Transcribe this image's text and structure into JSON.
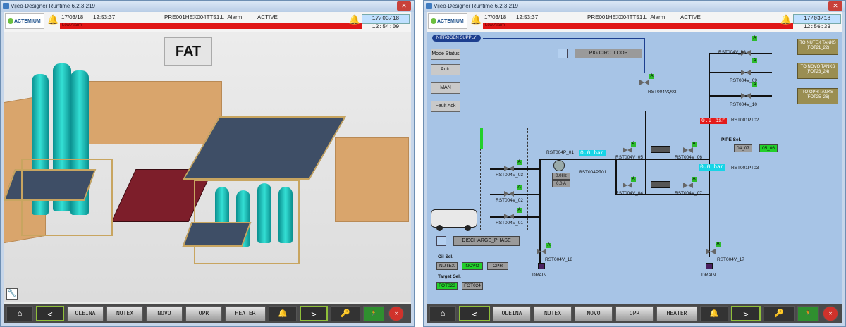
{
  "left_window": {
    "title": "Vijeo-Designer Runtime 6.2.3.219",
    "header": {
      "logo": "ACTEMIUM",
      "date": "17/03/18",
      "time": "12:53:37",
      "alarm_tag": "PRE001HEX004TT51.L_Alarm",
      "alarm_state": "ACTIVE",
      "alarm_text": "Low Alarm",
      "clock": "17/03/18 12:54:09"
    },
    "fat_label": "FAT",
    "nav": {
      "prev": "<",
      "items": [
        "OLEINA",
        "NUTEX",
        "NOVO",
        "OPR",
        "HEATER"
      ],
      "next": ">"
    }
  },
  "right_window": {
    "title": "Vijeo-Designer Runtime 6.2.3.219",
    "header": {
      "logo": "ACTEMIUM",
      "date": "17/03/18",
      "time": "12:53:37",
      "alarm_tag": "PRE001HEX004TT51.L_Alarm",
      "alarm_state": "ACTIVE",
      "alarm_text": "Low Alarm",
      "clock": "17/03/18 12:56:33"
    },
    "nitrogen_supply": "NITROGEN SUPPLY",
    "pig_loop": "PIG CIRC. LOOP",
    "side_buttons": [
      "Mode Status",
      "Auto",
      "MAN",
      "Fault Ack"
    ],
    "destinations": [
      "TO NUTEX TANKS (FOT21_22)",
      "TO NOVO TANKS (FOT23_24)",
      "TO OPR TANKS (FOT25_26)"
    ],
    "valves": {
      "v08": "RST004V_08",
      "v09": "RST004V_09",
      "v10": "RST004V_10",
      "vq03": "RST004VQ03",
      "v05": "RST004V_05",
      "v06": "RST004V_06",
      "v04": "RST004V_04",
      "v07": "RST004V_07",
      "v03": "RST004V_03",
      "v02": "RST004V_02",
      "v01": "RST004V_01",
      "v18": "RST004V_18",
      "v17": "RST004V_17"
    },
    "pt02_value": "0.0 bar",
    "pt02_tag": "RST001PT02",
    "pt03_value": "0.0 bar",
    "pt03_tag": "RST001PT03",
    "pump_tag": "RST004P_01",
    "pt01_value": "0.0 bar",
    "pt01_tag": "RST004PT01",
    "pump_freq": "0.0Hz",
    "pump_current": "0.0 A",
    "pipe_sel_label": "PIPE Sel.",
    "pipe_sel_a": "04_07",
    "pipe_sel_b": "05_06",
    "discharge_phase": "DISCHARGE_PHASE",
    "oil_sel_label": "Oil Sel.",
    "oil_options": [
      "NUTEX",
      "NOVO",
      "OPR"
    ],
    "target_sel_label": "Target Sel.",
    "target_options": [
      "FOT023",
      "FOT024"
    ],
    "drain_label": "DRAIN",
    "drain_label_2": "DRAIN",
    "a_badge": "A",
    "nav": {
      "prev": "<",
      "items": [
        "OLEINA",
        "NUTEX",
        "NOVO",
        "OPR",
        "HEATER"
      ],
      "next": ">"
    }
  },
  "colors": {
    "alarm_bar": "#e01616",
    "hmi_background": "#a7c4e6",
    "status_green": "#22d02a",
    "tank_teal": "#34e0d5"
  }
}
